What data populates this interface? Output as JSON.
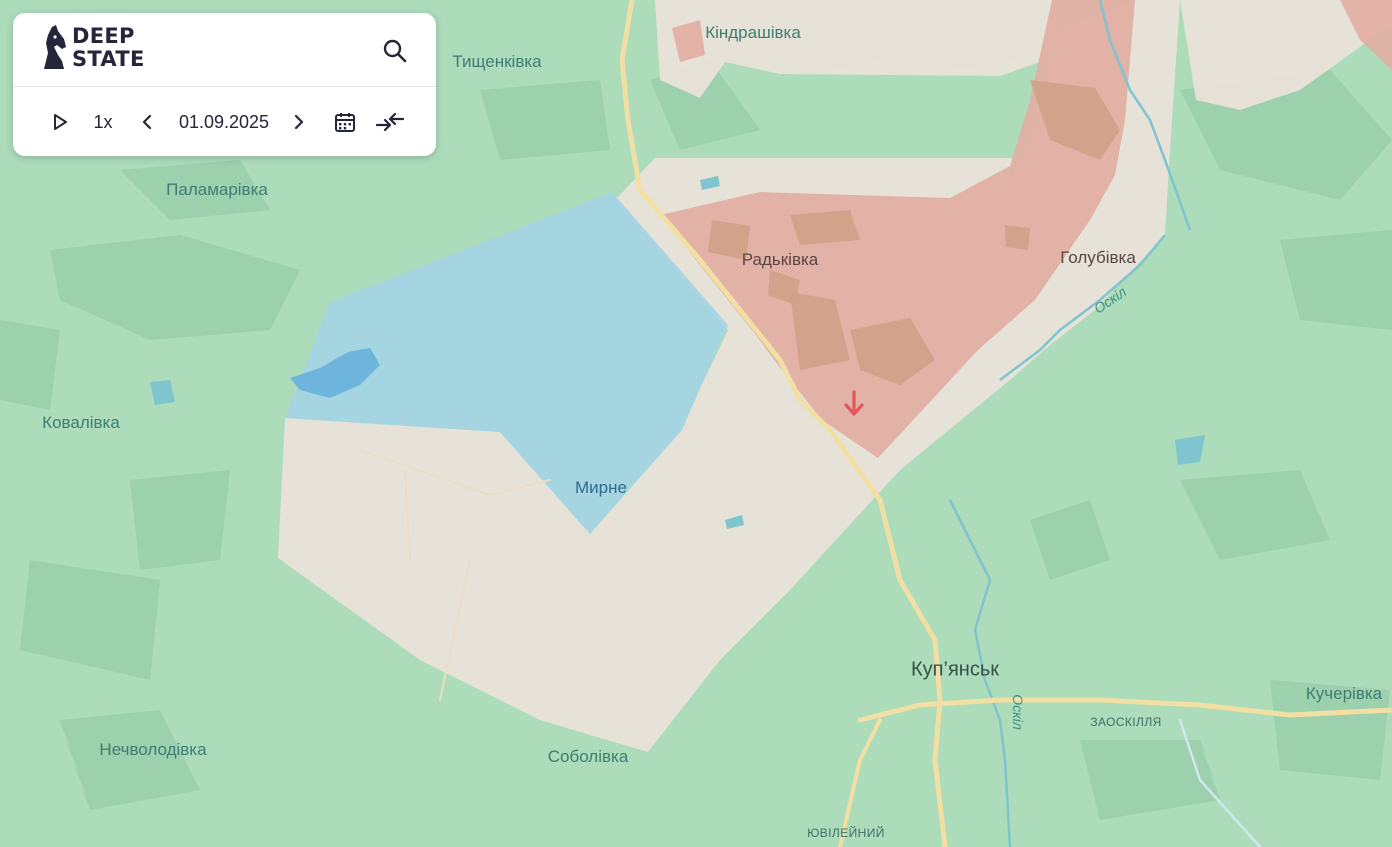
{
  "app": {
    "logo_line1": "DEEP",
    "logo_line2": "STATE"
  },
  "toolbar": {
    "speed": "1x",
    "date": "01.09.2025"
  },
  "icons": [
    "knight-logo-icon",
    "search-icon",
    "play-icon",
    "chevron-left-icon",
    "chevron-right-icon",
    "calendar-icon",
    "compress-icon",
    "arrow-down-icon"
  ],
  "colors": {
    "map_green": "#acdcba",
    "contested_beige": "#ece2da",
    "occupied_red": "#e2aea3",
    "liberated_blue": "#a6d4e5",
    "road_yellow": "#f1dfa4",
    "water": "#7fc4cf",
    "panel_bg": "#ffffff",
    "text_dark": "#24263a",
    "arrow_red": "#e0575c"
  },
  "places": {
    "kindrashivka": "Кіндрашівка",
    "tyshchenkivka": "Тищенківка",
    "palamarivka": "Паламарівка",
    "radkivka": "Радьківка",
    "holubivka": "Голубівка",
    "oskil_1": "Оскіл",
    "kovalivka": "Ковалівка",
    "myrne": "Мирне",
    "kupiansk": "Куп’янськ",
    "oskil_2": "Оскіл",
    "zaoskillia": "ЗАОСКІЛЛЯ",
    "kucherivka": "Кучерівка",
    "nechvolodivka": "Нечволодівка",
    "sobolivka": "Соболівка",
    "yuvileinyi": "ЮВІЛЕЙНИЙ"
  }
}
